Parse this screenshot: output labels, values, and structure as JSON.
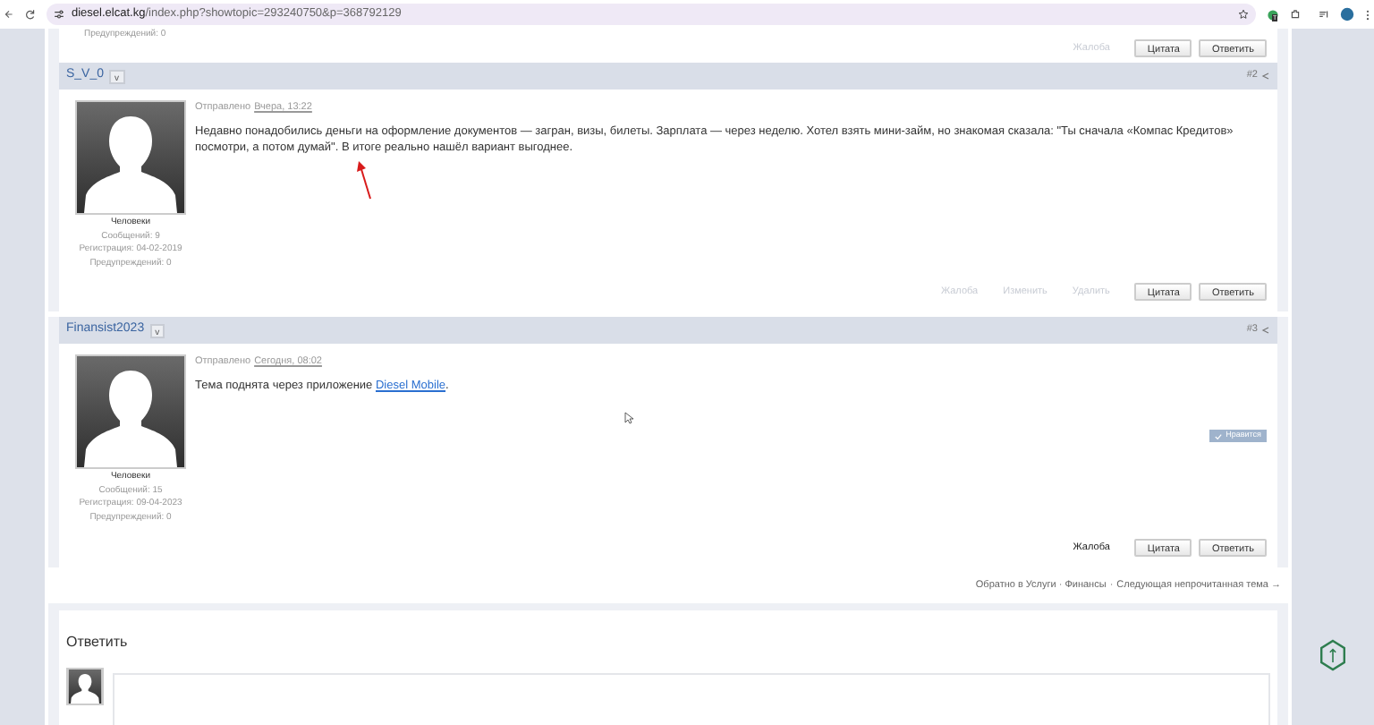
{
  "browser": {
    "url_host": "diesel.elcat.kg",
    "url_path": "/index.php?showtopic=293240750&p=368792129",
    "extension_badge": "T"
  },
  "previous_post": {
    "warnings": "Предупреждений: 0",
    "actions": [
      {
        "label": "Жалоба",
        "disabled": true
      }
    ],
    "buttons": [
      "Цитата",
      "Ответить"
    ]
  },
  "posts": [
    {
      "author": "S_V_0",
      "menu": "v",
      "number": "#2",
      "posted_label": "Отправлено",
      "date": "Вчера, 13:22",
      "text": "Недавно понадобились деньги на оформление документов — загран, визы, билеты. Зарплата — через неделю. Хотел взять мини-займ, но знакомая сказала: \"Ты сначала «Компас Кредитов» посмотри, а потом думай\". В итоге реально нашёл вариант выгоднее.",
      "annotation": {
        "kind": "arrow"
      },
      "group": "Человеки",
      "messages": "Сообщений: 9",
      "registered": "Регистрация: 04-02-2019",
      "warnings": "Предупреждений: 0",
      "actions": [
        {
          "label": "Жалоба",
          "disabled": true
        },
        {
          "label": "Изменить",
          "disabled": true
        },
        {
          "label": "Удалить",
          "disabled": true
        }
      ],
      "buttons": [
        "Цитата",
        "Ответить"
      ]
    },
    {
      "author": "Finansist2023",
      "menu": "v",
      "number": "#3",
      "posted_label": "Отправлено",
      "date": "Сегодня, 08:02",
      "text": "Тема поднята через приложение ",
      "link": "Diesel Mobile",
      "link_suffix": ".",
      "pointer": {
        "kind": "cursor"
      },
      "group": "Человеки",
      "messages": "Сообщений: 15",
      "registered": "Регистрация: 09-04-2023",
      "warnings": "Предупреждений: 0",
      "like": "Нравится",
      "actions": [
        {
          "label": "Жалоба",
          "disabled": false
        }
      ],
      "buttons": [
        "Цитата",
        "Ответить"
      ]
    }
  ],
  "navigation": [
    "Обратно в Услуги · Финансы",
    "·",
    "Следующая непрочитанная тема →"
  ],
  "reply": {
    "title": "Ответить"
  }
}
